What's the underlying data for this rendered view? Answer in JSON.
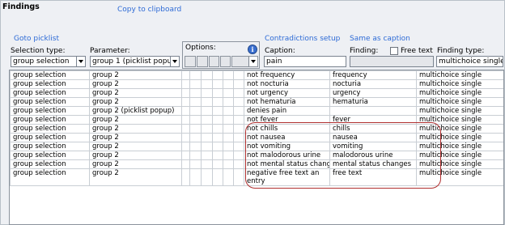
{
  "panel": {
    "title": "Findings",
    "copy_link": "Copy to clipboard",
    "goto_link": "Goto picklist",
    "contradictions_link": "Contradictions setup",
    "same_as_caption_link": "Same as caption"
  },
  "filters": {
    "selection_type_label": "Selection type:",
    "selection_type_value": "group selection",
    "parameter_label": "Parameter:",
    "parameter_value": "group 1 (picklist popu",
    "options_label": "Options:",
    "caption_label": "Caption:",
    "caption_value": "pain",
    "finding_label": "Finding:",
    "free_text_label": "Free text",
    "finding_type_label": "Finding type:",
    "finding_type_value": "multichoice single"
  },
  "icons": {
    "info": "info-icon",
    "dropdown": "chevron-down-icon"
  },
  "grid": {
    "rows": [
      {
        "selection": "group selection",
        "parameter": "group 2",
        "caption": "not frequency",
        "finding": "frequency",
        "type": "multichoice single"
      },
      {
        "selection": "group selection",
        "parameter": "group 2",
        "caption": "not nocturia",
        "finding": "nocturia",
        "type": "multichoice single"
      },
      {
        "selection": "group selection",
        "parameter": "group 2",
        "caption": "not urgency",
        "finding": "urgency",
        "type": "multichoice single"
      },
      {
        "selection": "group selection",
        "parameter": "group 2",
        "caption": "not hematuria",
        "finding": "hematuria",
        "type": "multichoice single"
      },
      {
        "selection": "group selection",
        "parameter": "group 2 (picklist popup)",
        "caption": "denies pain",
        "finding": "",
        "type": "multichoice single"
      },
      {
        "selection": "group selection",
        "parameter": "group 2",
        "caption": "not fever",
        "finding": "fever",
        "type": "multichoice single"
      },
      {
        "selection": "group selection",
        "parameter": "group 2",
        "caption": "not chills",
        "finding": "chills",
        "type": "multichoice single"
      },
      {
        "selection": "group selection",
        "parameter": "group 2",
        "caption": "not nausea",
        "finding": "nausea",
        "type": "multichoice single"
      },
      {
        "selection": "group selection",
        "parameter": "group 2",
        "caption": "not vomiting",
        "finding": "vomiting",
        "type": "multichoice single"
      },
      {
        "selection": "group selection",
        "parameter": "group 2",
        "caption": "not malodorous urine",
        "finding": "malodorous urine",
        "type": "multichoice single"
      },
      {
        "selection": "group selection",
        "parameter": "group 2",
        "caption": "not mental status changes",
        "finding": "mental status changes",
        "type": "multichoice single"
      },
      {
        "selection": "group selection",
        "parameter": "group 2",
        "caption": "negative free text an entry",
        "finding": "free text",
        "type": "multichoice single"
      }
    ]
  }
}
